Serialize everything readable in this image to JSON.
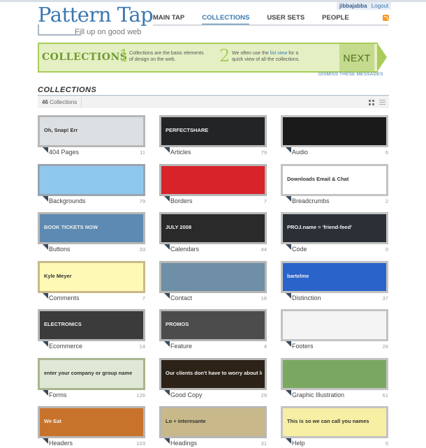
{
  "header": {
    "logo": "Pattern Tap",
    "tagline": "Fill up on good web",
    "user_name": "jibbajabba",
    "logout": "Logout",
    "nav": [
      "MAIN TAP",
      "COLLECTIONS",
      "USER SETS",
      "PEOPLE"
    ],
    "active_nav": "COLLECTIONS"
  },
  "banner": {
    "title": "COLLECTIONS",
    "step1_num": "1",
    "step1_text": "Collections are the basic elements of design on the web.",
    "step2_num": "2",
    "step2_pre": "We often use the",
    "step2_link": "list view",
    "step2_post": "for a quick view of all the collections.",
    "next": "NEXT",
    "dismiss": "DISMISS THESE MESSAGES"
  },
  "section": {
    "heading": "COLLECTIONS",
    "count_num": "46",
    "count_label": "Collections"
  },
  "tiles": [
    {
      "name": "404 Pages",
      "count": "11",
      "bg": "#dde0e3",
      "border": "#b7b7b7",
      "caption": "Oh, Snap! Err"
    },
    {
      "name": "Articles",
      "count": "79",
      "bg": "#222426",
      "border": "#b7b7b7",
      "caption": "PERFECTSHARE"
    },
    {
      "name": "Audio",
      "count": "6",
      "bg": "#1a1a1a",
      "border": "#c3c3c3",
      "caption": ""
    },
    {
      "name": "Backgrounds",
      "count": "79",
      "bg": "#8fc8ee",
      "border": "#9aa5b0",
      "caption": ""
    },
    {
      "name": "Borders",
      "count": "7",
      "bg": "#d8232b",
      "border": "#b7b7b7",
      "caption": ""
    },
    {
      "name": "Breadcrumbs",
      "count": "2",
      "bg": "#ffffff",
      "border": "#c3c3c3",
      "caption": "Downloads   Email & Chat"
    },
    {
      "name": "Buttons",
      "count": "33",
      "bg": "#5c8ab2",
      "border": "#b7b7b7",
      "caption": "BOOK TICKETS NOW"
    },
    {
      "name": "Calendars",
      "count": "44",
      "bg": "#2a2a2a",
      "border": "#b7b7b7",
      "caption": "JULY 2008"
    },
    {
      "name": "Code",
      "count": "0",
      "bg": "#2b2f36",
      "border": "#c3c3c3",
      "caption": "PROJ.name = 'friend-feed'"
    },
    {
      "name": "Comments",
      "count": "7",
      "bg": "#fef9b5",
      "border": "#c9b98a",
      "caption": "Kyle Meyer"
    },
    {
      "name": "Contact",
      "count": "16",
      "bg": "#6e8fa5",
      "border": "#b7b7b7",
      "caption": ""
    },
    {
      "name": "Distinction",
      "count": "37",
      "bg": "#2a63c9",
      "border": "#c3c3c3",
      "caption": "bartelme"
    },
    {
      "name": "Ecommerce",
      "count": "14",
      "bg": "#3b3b3b",
      "border": "#b7b7b7",
      "caption": "ELECTRONICS"
    },
    {
      "name": "Feature",
      "count": "4",
      "bg": "#4c4c4c",
      "border": "#b7b7b7",
      "caption": "PROMOS"
    },
    {
      "name": "Footers",
      "count": "26",
      "bg": "#f4f4f4",
      "border": "#c3c3c3",
      "caption": ""
    },
    {
      "name": "Forms",
      "count": "126",
      "bg": "#dfe8d5",
      "border": "#a9b58f",
      "caption": "enter your company or group name"
    },
    {
      "name": "Good Copy",
      "count": "29",
      "bg": "#2c2218",
      "border": "#b7b7b7",
      "caption": "Our clients don't have to worry about learning geek speak."
    },
    {
      "name": "Graphic Illustration",
      "count": "61",
      "bg": "#7aa860",
      "border": "#c3c3c3",
      "caption": ""
    },
    {
      "name": "Headers",
      "count": "103",
      "bg": "#c8732c",
      "border": "#b7b7b7",
      "caption": "We Eat"
    },
    {
      "name": "Headings",
      "count": "31",
      "bg": "#c9b98a",
      "border": "#b7b7b7",
      "caption": "Lo + interesante"
    },
    {
      "name": "Help",
      "count": "5",
      "bg": "#f6efa4",
      "border": "#c3c3c3",
      "caption": "This is so we can call you names"
    }
  ],
  "colors": {
    "accent": "#3a78b0",
    "banner_bg": "#e4f0c4",
    "banner_border": "#a9cc5a"
  }
}
